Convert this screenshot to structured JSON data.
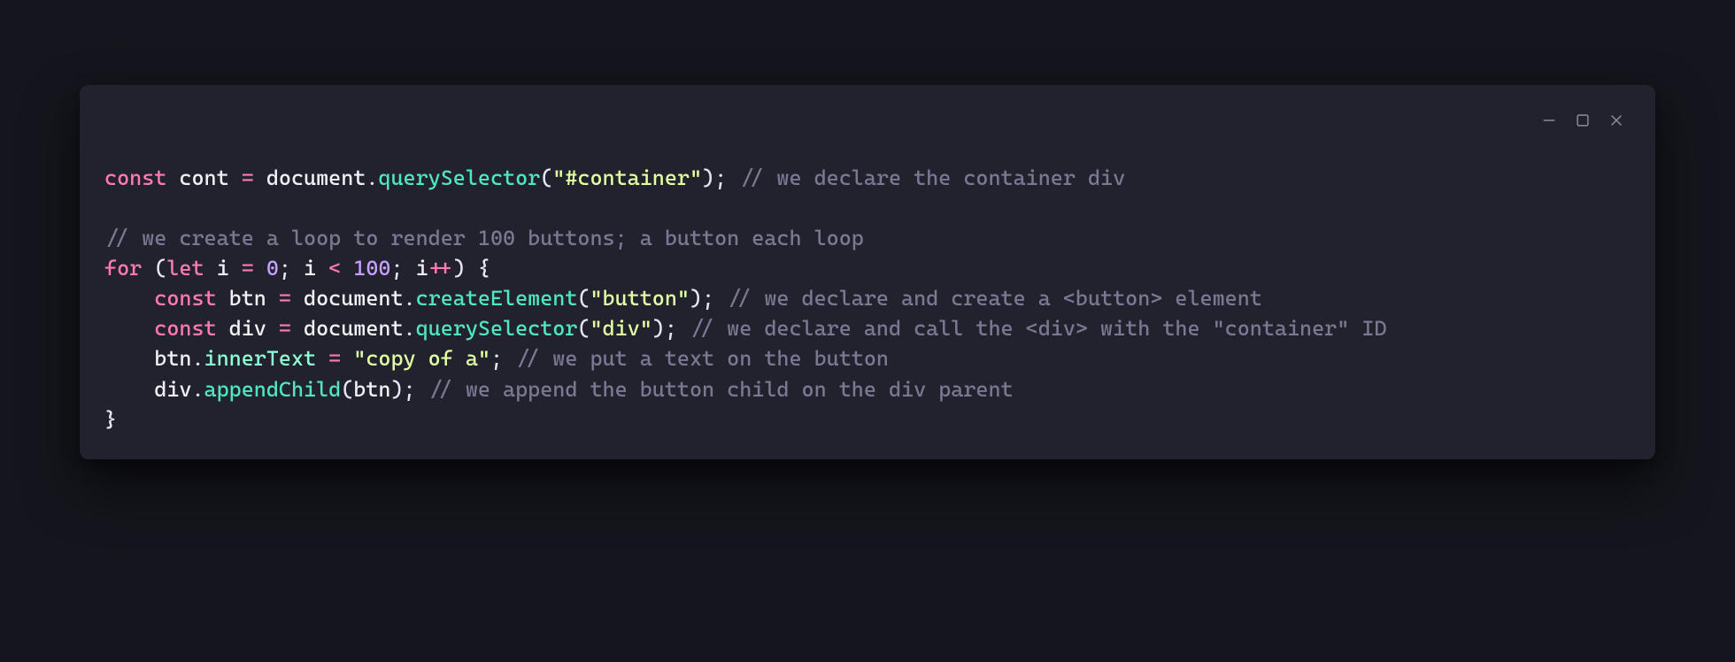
{
  "window": {
    "controls": {
      "minimize": "minimize-icon",
      "maximize": "maximize-icon",
      "close": "close-icon"
    }
  },
  "code": {
    "lines": [
      [
        {
          "t": "kw",
          "v": "const"
        },
        {
          "t": "sp",
          "v": " "
        },
        {
          "t": "var",
          "v": "cont"
        },
        {
          "t": "sp",
          "v": " "
        },
        {
          "t": "op",
          "v": "="
        },
        {
          "t": "sp",
          "v": " "
        },
        {
          "t": "obj",
          "v": "document"
        },
        {
          "t": "pun",
          "v": "."
        },
        {
          "t": "fn",
          "v": "querySelector"
        },
        {
          "t": "pun",
          "v": "("
        },
        {
          "t": "str",
          "v": "\"#container\""
        },
        {
          "t": "pun",
          "v": ");"
        },
        {
          "t": "sp",
          "v": " "
        },
        {
          "t": "com",
          "v": "// we declare the container div"
        }
      ],
      [],
      [
        {
          "t": "com",
          "v": "// we create a loop to render 100 buttons; a button each loop"
        }
      ],
      [
        {
          "t": "kw",
          "v": "for"
        },
        {
          "t": "sp",
          "v": " "
        },
        {
          "t": "pun",
          "v": "("
        },
        {
          "t": "kw",
          "v": "let"
        },
        {
          "t": "sp",
          "v": " "
        },
        {
          "t": "var",
          "v": "i"
        },
        {
          "t": "sp",
          "v": " "
        },
        {
          "t": "op",
          "v": "="
        },
        {
          "t": "sp",
          "v": " "
        },
        {
          "t": "num",
          "v": "0"
        },
        {
          "t": "pun",
          "v": ";"
        },
        {
          "t": "sp",
          "v": " "
        },
        {
          "t": "var",
          "v": "i"
        },
        {
          "t": "sp",
          "v": " "
        },
        {
          "t": "op",
          "v": "<"
        },
        {
          "t": "sp",
          "v": " "
        },
        {
          "t": "num",
          "v": "100"
        },
        {
          "t": "pun",
          "v": ";"
        },
        {
          "t": "sp",
          "v": " "
        },
        {
          "t": "var",
          "v": "i"
        },
        {
          "t": "op",
          "v": "++"
        },
        {
          "t": "pun",
          "v": ")"
        },
        {
          "t": "sp",
          "v": " "
        },
        {
          "t": "pun",
          "v": "{"
        }
      ],
      [
        {
          "t": "sp",
          "v": "    "
        },
        {
          "t": "kw",
          "v": "const"
        },
        {
          "t": "sp",
          "v": " "
        },
        {
          "t": "var",
          "v": "btn"
        },
        {
          "t": "sp",
          "v": " "
        },
        {
          "t": "op",
          "v": "="
        },
        {
          "t": "sp",
          "v": " "
        },
        {
          "t": "obj",
          "v": "document"
        },
        {
          "t": "pun",
          "v": "."
        },
        {
          "t": "fn",
          "v": "createElement"
        },
        {
          "t": "pun",
          "v": "("
        },
        {
          "t": "str",
          "v": "\"button\""
        },
        {
          "t": "pun",
          "v": ");"
        },
        {
          "t": "sp",
          "v": " "
        },
        {
          "t": "com",
          "v": "// we declare and create a <button> element"
        }
      ],
      [
        {
          "t": "sp",
          "v": "    "
        },
        {
          "t": "kw",
          "v": "const"
        },
        {
          "t": "sp",
          "v": " "
        },
        {
          "t": "var",
          "v": "div"
        },
        {
          "t": "sp",
          "v": " "
        },
        {
          "t": "op",
          "v": "="
        },
        {
          "t": "sp",
          "v": " "
        },
        {
          "t": "obj",
          "v": "document"
        },
        {
          "t": "pun",
          "v": "."
        },
        {
          "t": "fn",
          "v": "querySelector"
        },
        {
          "t": "pun",
          "v": "("
        },
        {
          "t": "str",
          "v": "\"div\""
        },
        {
          "t": "pun",
          "v": ");"
        },
        {
          "t": "sp",
          "v": " "
        },
        {
          "t": "com",
          "v": "// we declare and call the <div> with the \"container\" ID"
        }
      ],
      [
        {
          "t": "sp",
          "v": "    "
        },
        {
          "t": "var",
          "v": "btn"
        },
        {
          "t": "pun",
          "v": "."
        },
        {
          "t": "prop",
          "v": "innerText"
        },
        {
          "t": "sp",
          "v": " "
        },
        {
          "t": "op",
          "v": "="
        },
        {
          "t": "sp",
          "v": " "
        },
        {
          "t": "str",
          "v": "\"copy of a\""
        },
        {
          "t": "pun",
          "v": ";"
        },
        {
          "t": "sp",
          "v": " "
        },
        {
          "t": "com",
          "v": "// we put a text on the button"
        }
      ],
      [
        {
          "t": "sp",
          "v": "    "
        },
        {
          "t": "var",
          "v": "div"
        },
        {
          "t": "pun",
          "v": "."
        },
        {
          "t": "fn",
          "v": "appendChild"
        },
        {
          "t": "pun",
          "v": "("
        },
        {
          "t": "var",
          "v": "btn"
        },
        {
          "t": "pun",
          "v": ");"
        },
        {
          "t": "sp",
          "v": " "
        },
        {
          "t": "com",
          "v": "// we append the button child on the div parent"
        }
      ],
      [
        {
          "t": "pun",
          "v": "}"
        }
      ]
    ]
  }
}
